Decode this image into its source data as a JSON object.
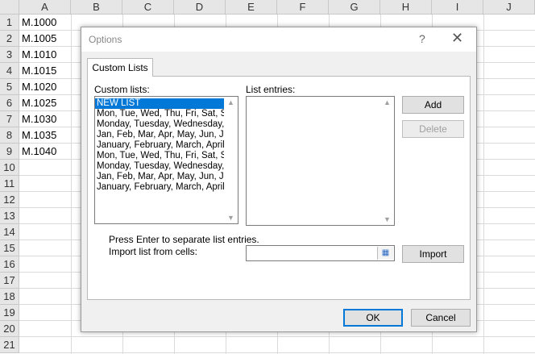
{
  "sheet": {
    "columns": [
      "A",
      "B",
      "C",
      "D",
      "E",
      "F",
      "G",
      "H",
      "I",
      "J"
    ],
    "rows": [
      "1",
      "2",
      "3",
      "4",
      "5",
      "6",
      "7",
      "8",
      "9",
      "10",
      "11",
      "12",
      "13",
      "14",
      "15",
      "16",
      "17",
      "18",
      "19",
      "20",
      "21"
    ],
    "column_a_values": [
      "M.1000",
      "M.1005",
      "M.1010",
      "M.1015",
      "M.1020",
      "M.1025",
      "M.1030",
      "M.1035",
      "M.1040"
    ]
  },
  "dialog": {
    "title": "Options",
    "help_glyph": "?",
    "close_glyph": "✕",
    "tab": "Custom Lists",
    "custom_lists_label": "Custom lists:",
    "list_entries_label": "List entries:",
    "custom_lists": [
      "NEW LIST",
      "Mon, Tue, Wed, Thu, Fri, Sat, Sun",
      "Monday, Tuesday, Wednesday, Thursday",
      "Jan, Feb, Mar, Apr, May, Jun, Jul",
      "January, February, March, April",
      "Mon, Tue, Wed, Thu, Fri, Sat, Sun",
      "Monday, Tuesday, Wednesday, Thursday",
      "Jan, Feb, Mar, Apr, May, Jun, Jul",
      "January, February, March, April"
    ],
    "hint": "Press Enter to separate list entries.",
    "import_label": "Import list from cells:",
    "import_value": "",
    "buttons": {
      "add": "Add",
      "delete": "Delete",
      "import": "Import",
      "ok": "OK",
      "cancel": "Cancel"
    }
  }
}
